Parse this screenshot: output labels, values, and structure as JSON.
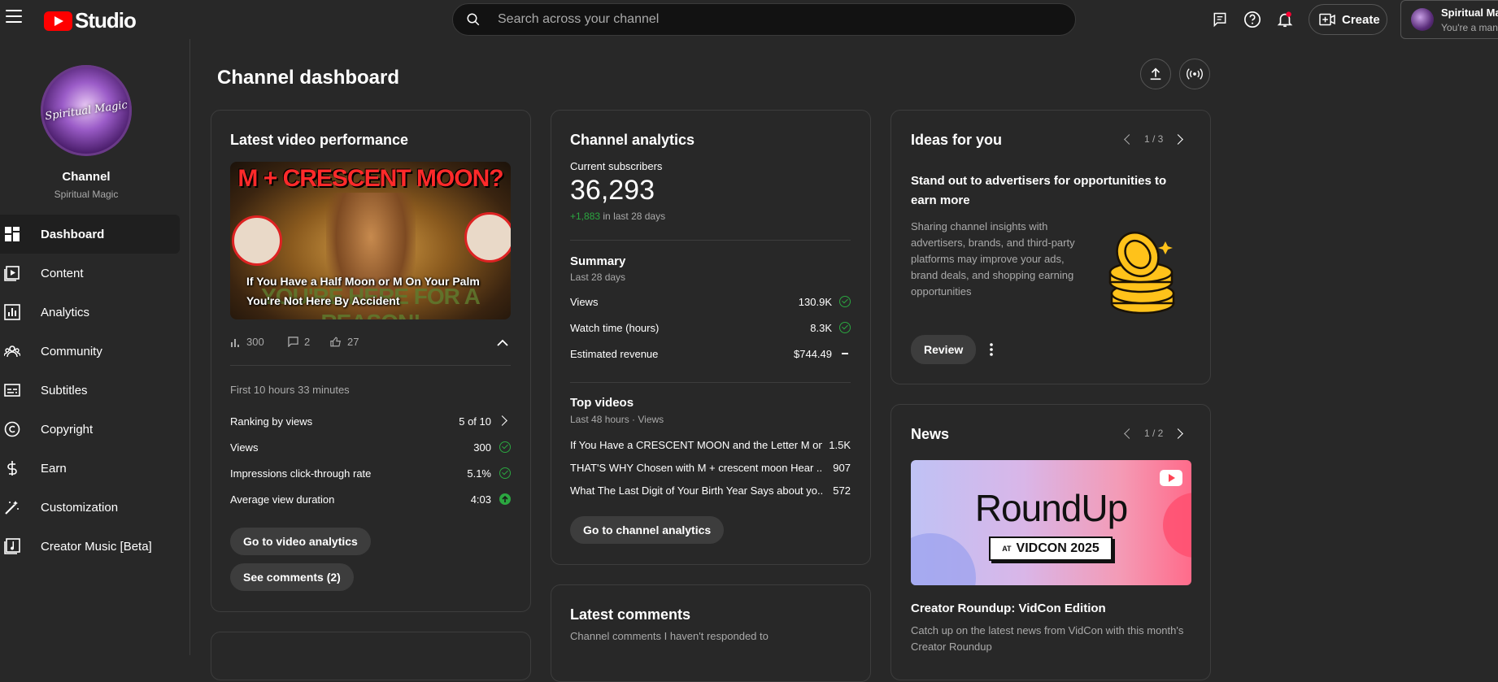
{
  "app": {
    "brand": "Studio"
  },
  "search": {
    "placeholder": "Search across your channel"
  },
  "header": {
    "create_label": "Create",
    "account_name": "Spiritual Magic",
    "account_sub": "You're a manager"
  },
  "sidebar": {
    "channel_title": "Channel",
    "channel_name": "Spiritual Magic",
    "avatar_text": "Spiritual Magic",
    "items": [
      {
        "label": "Dashboard",
        "icon": "dashboard-icon"
      },
      {
        "label": "Content",
        "icon": "content-icon"
      },
      {
        "label": "Analytics",
        "icon": "analytics-icon"
      },
      {
        "label": "Community",
        "icon": "community-icon"
      },
      {
        "label": "Subtitles",
        "icon": "subtitles-icon"
      },
      {
        "label": "Copyright",
        "icon": "copyright-icon"
      },
      {
        "label": "Earn",
        "icon": "earn-icon"
      },
      {
        "label": "Customization",
        "icon": "customization-icon"
      },
      {
        "label": "Creator Music [Beta]",
        "icon": "creator-music-icon"
      }
    ]
  },
  "main": {
    "title": "Channel dashboard"
  },
  "latest_video": {
    "title": "Latest video performance",
    "thumb_headline": "M + CRESCENT MOON?",
    "thumb_bg_text": "YOU'RE HERE FOR A REASON!",
    "thumb_caption_1": "If You Have a Half Moon or M On Your Palm",
    "thumb_caption_2": "You're Not Here By Accident",
    "views_count": "300",
    "comments_count": "2",
    "likes_count": "27",
    "period": "First 10 hours 33 minutes",
    "rows": [
      {
        "label": "Ranking by views",
        "value": "5 of 10"
      },
      {
        "label": "Views",
        "value": "300"
      },
      {
        "label": "Impressions click-through rate",
        "value": "5.1%"
      },
      {
        "label": "Average view duration",
        "value": "4:03"
      }
    ],
    "btn_video_analytics": "Go to video analytics",
    "btn_comments": "See comments (2)"
  },
  "channel_analytics": {
    "title": "Channel analytics",
    "subs_label": "Current subscribers",
    "subs_value": "36,293",
    "subs_delta": "+1,883",
    "subs_delta_period": "in last 28 days",
    "summary_title": "Summary",
    "summary_period": "Last 28 days",
    "summary_rows": [
      {
        "label": "Views",
        "value": "130.9K"
      },
      {
        "label": "Watch time (hours)",
        "value": "8.3K"
      },
      {
        "label": "Estimated revenue",
        "value": "$744.49"
      }
    ],
    "top_title": "Top videos",
    "top_period": "Last 48 hours · Views",
    "top_videos": [
      {
        "title": "If You Have a CRESCENT MOON and the Letter M on...",
        "views": "1.5K"
      },
      {
        "title": "THAT'S WHY Chosen with M + crescent moon Hear ...",
        "views": "907"
      },
      {
        "title": "What The Last Digit of Your Birth Year Says about yo...",
        "views": "572"
      }
    ],
    "btn": "Go to channel analytics"
  },
  "latest_comments": {
    "title": "Latest comments",
    "subtitle": "Channel comments I haven't responded to"
  },
  "ideas": {
    "title": "Ideas for you",
    "pager": "1 / 3",
    "headline": "Stand out to advertisers for opportunities to earn more",
    "body": "Sharing channel insights with advertisers, brands, and third-party platforms may improve your ads, brand deals, and shopping earning opportunities",
    "btn": "Review"
  },
  "news": {
    "title": "News",
    "pager": "1 / 2",
    "image_title": "RoundUp",
    "image_at": "AT",
    "image_event": "VIDCON 2025",
    "headline": "Creator Roundup: VidCon Edition",
    "body": "Catch up on the latest news from VidCon with this month's Creator Roundup"
  },
  "colors": {
    "accent_red": "#ff0000",
    "positive": "#2ba640",
    "background": "#282828"
  }
}
